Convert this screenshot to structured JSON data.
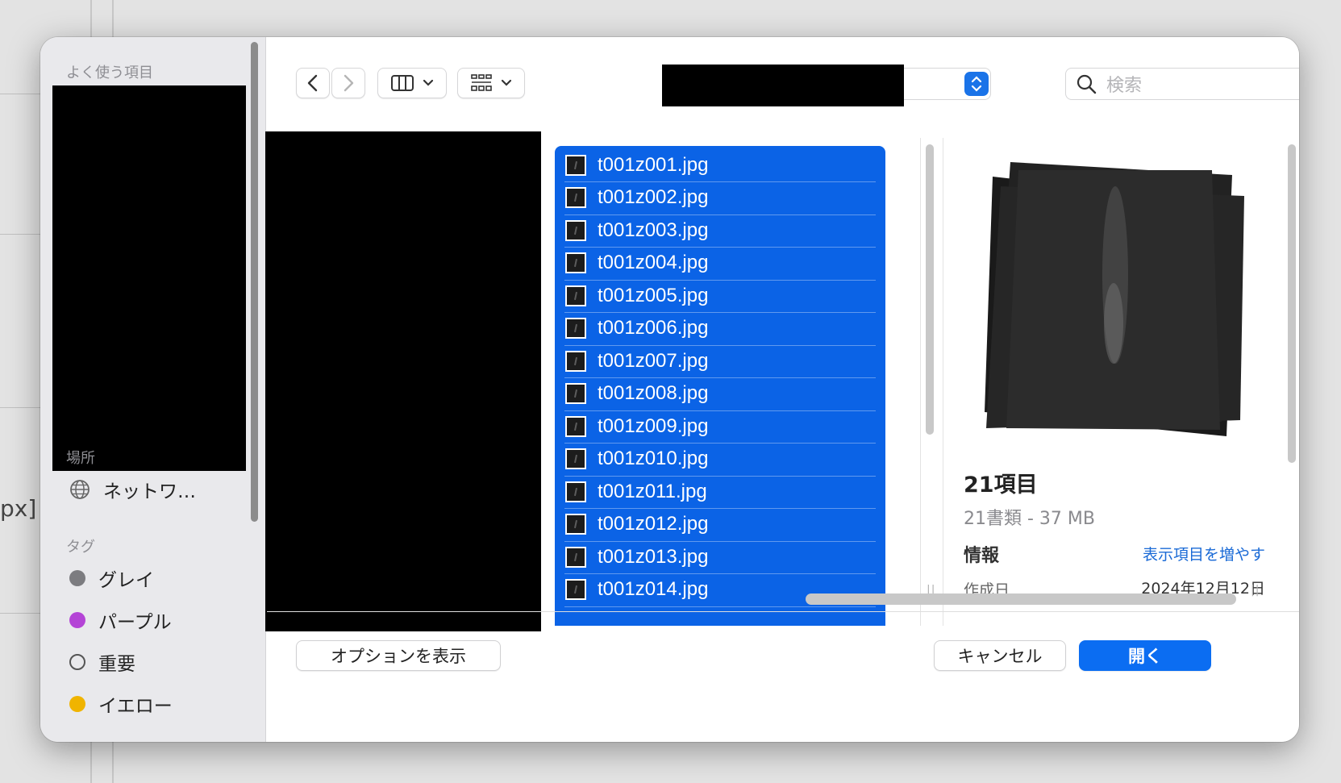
{
  "background": {
    "partial_text": "px]"
  },
  "sidebar": {
    "favorites_label": "よく使う項目",
    "locations_label": "場所",
    "network_label": "ネットワ…",
    "tags_label": "タグ",
    "tags": [
      {
        "label": "グレイ",
        "color": "#7c7c80"
      },
      {
        "label": "パープル",
        "color": "#b444d6"
      },
      {
        "label": "重要",
        "color": "hollow"
      },
      {
        "label": "イエロー",
        "color": "#f0b400"
      }
    ]
  },
  "toolbar": {
    "back_icon": "chevron-left-icon",
    "forward_icon": "chevron-right-icon",
    "view_icon": "column-view-icon",
    "group_icon": "grid-group-icon",
    "search_placeholder": "検索",
    "accent": "#1a73e8"
  },
  "files": [
    "t001z001.jpg",
    "t001z002.jpg",
    "t001z003.jpg",
    "t001z004.jpg",
    "t001z005.jpg",
    "t001z006.jpg",
    "t001z007.jpg",
    "t001z008.jpg",
    "t001z009.jpg",
    "t001z010.jpg",
    "t001z011.jpg",
    "t001z012.jpg",
    "t001z013.jpg",
    "t001z014.jpg"
  ],
  "preview": {
    "title": "21項目",
    "subtitle": "21書類 - 37 MB",
    "info_label": "情報",
    "show_more": "表示項目を増やす",
    "created_label": "作成日",
    "created_value": "2024年12月12日"
  },
  "footer": {
    "options_label": "オプションを表示",
    "cancel_label": "キャンセル",
    "open_label": "開く"
  }
}
